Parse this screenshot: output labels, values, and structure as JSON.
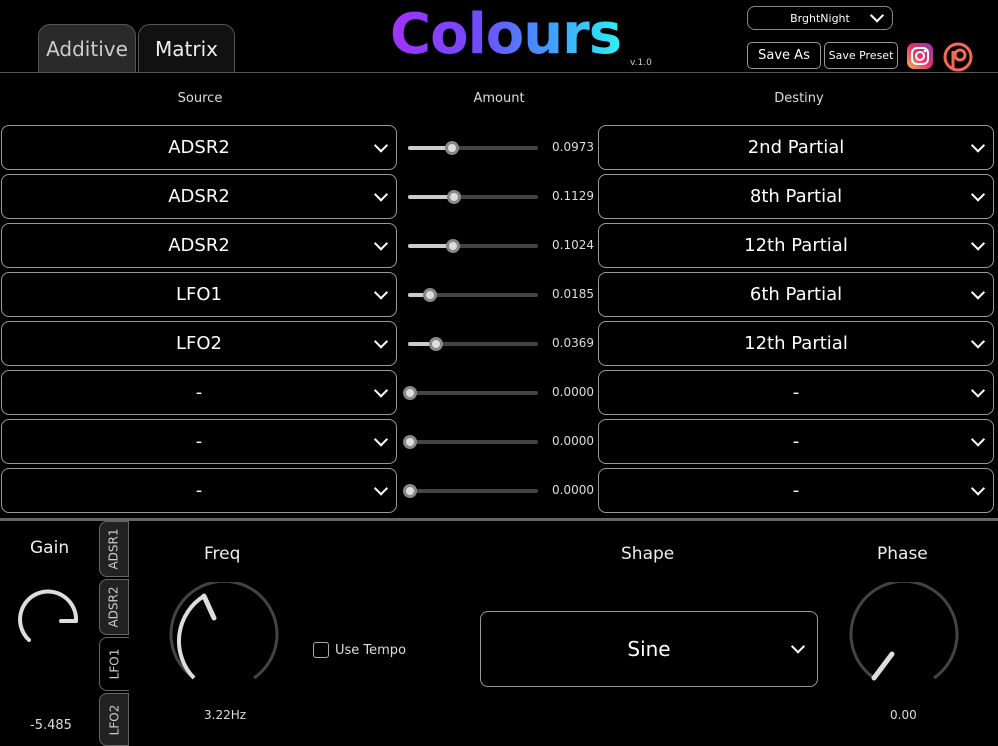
{
  "tabs": [
    "Additive",
    "Matrix"
  ],
  "logo": "Colours",
  "version": "v.1.0",
  "preset": "BrghtNight",
  "buttons": {
    "save_as": "Save As",
    "save_preset": "Save Preset"
  },
  "columns": {
    "source": "Source",
    "amount": "Amount",
    "destiny": "Destiny"
  },
  "rows": [
    {
      "source": "ADSR2",
      "amount": "0.0973",
      "amount_frac": 0.32,
      "dest": "2nd Partial"
    },
    {
      "source": "ADSR2",
      "amount": "0.1129",
      "amount_frac": 0.34,
      "dest": "8th Partial"
    },
    {
      "source": "ADSR2",
      "amount": "0.1024",
      "amount_frac": 0.33,
      "dest": "12th Partial"
    },
    {
      "source": "LFO1",
      "amount": "0.0185",
      "amount_frac": 0.15,
      "dest": "6th Partial"
    },
    {
      "source": "LFO2",
      "amount": "0.0369",
      "amount_frac": 0.2,
      "dest": "12th Partial"
    },
    {
      "source": "-",
      "amount": "0.0000",
      "amount_frac": 0.0,
      "dest": "-"
    },
    {
      "source": "-",
      "amount": "0.0000",
      "amount_frac": 0.0,
      "dest": "-"
    },
    {
      "source": "-",
      "amount": "0.0000",
      "amount_frac": 0.0,
      "dest": "-"
    }
  ],
  "bottom": {
    "gain_label": "Gain",
    "gain_value": "-5.485",
    "mod_tabs": [
      "ADSR1",
      "ADSR2",
      "LFO1",
      "LFO2"
    ],
    "freq_label": "Freq",
    "freq_value": "3.22Hz",
    "use_tempo": "Use Tempo",
    "shape_label": "Shape",
    "shape_value": "Sine",
    "phase_label": "Phase",
    "phase_value": "0.00"
  },
  "icons": {
    "instagram": "instagram-icon",
    "patreon": "patreon-icon"
  }
}
